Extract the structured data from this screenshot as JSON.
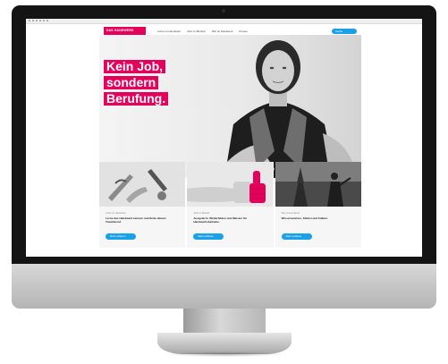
{
  "site": {
    "logo_text": "DAS HANDWERK",
    "nav": [
      "Lehre im Handwerk",
      "Jobs im Betrieb",
      "Wer ist Handwerk",
      "Presse"
    ],
    "search_label": "Suche",
    "headline": [
      "Kein Job,",
      "sondern",
      "Berufung."
    ],
    "cards": [
      {
        "kicker": "Lehre im Handwerk",
        "title": "Lerne das Handwerk kennen und finde deinen Traumberuf.",
        "button": "Mehr erfahren"
      },
      {
        "kicker": "Jobs im Betrieb",
        "title": "Ausgelernt. Weiterbilden und Meister für Handwerksbetriebe.",
        "button": "Mehr erfahren"
      },
      {
        "kicker": "Wer ist Handwerk",
        "title": "Wissenswertes, Zahlen und Fakten.",
        "button": "Mehr erfahren"
      }
    ]
  },
  "colors": {
    "accent": "#e5005c",
    "button": "#19a0e6",
    "bezel": "#141414"
  }
}
